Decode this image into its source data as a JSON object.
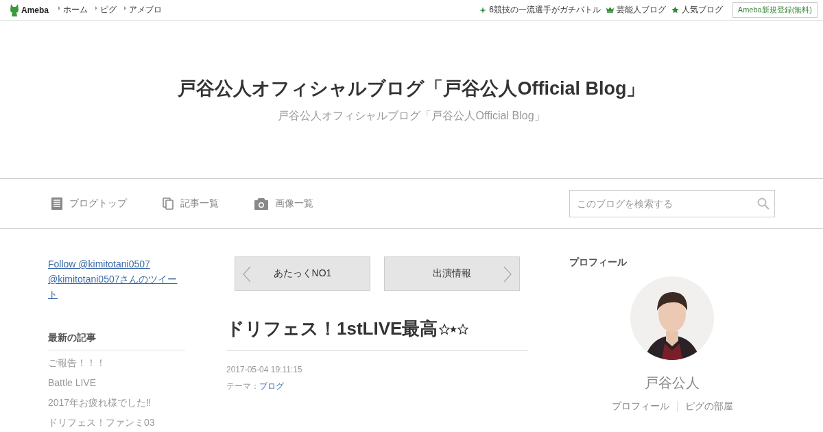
{
  "topbar": {
    "logo": "Ameba",
    "links": [
      "ホーム",
      "ピグ",
      "アメブロ"
    ],
    "promos": [
      {
        "kind": "sparkle",
        "label": "6競技の一流選手がガチバトル"
      },
      {
        "kind": "crown",
        "label": "芸能人ブログ"
      },
      {
        "kind": "star",
        "label": "人気ブログ"
      }
    ],
    "signup": "Ameba新規登録(無料)"
  },
  "header": {
    "title": "戸谷公人オフィシャルブログ「戸谷公人Official Blog」",
    "subtitle": "戸谷公人オフィシャルブログ「戸谷公人Official Blog」"
  },
  "nav": {
    "items": [
      {
        "kind": "top",
        "label": "ブログトップ"
      },
      {
        "kind": "list",
        "label": "記事一覧"
      },
      {
        "kind": "images",
        "label": "画像一覧"
      }
    ],
    "search": {
      "placeholder": "このブログを検索する"
    }
  },
  "sidebar": {
    "twitter": [
      "Follow @kimitotani0507",
      "@kimitotani0507さんのツイート"
    ],
    "recent": {
      "heading": "最新の記事",
      "items": [
        "ご報告！！！",
        "Battle LIVE",
        "2017年お疲れ様でした‼",
        "ドリフェス！ファンミ03"
      ]
    }
  },
  "article": {
    "prev": "あたっくNO1",
    "next": "出演情報",
    "title": "ドリフェス！1stLIVE最高",
    "date": "2017-05-04 19:11:15",
    "theme_label": "テーマ：",
    "theme": "ブログ"
  },
  "profile": {
    "heading": "プロフィール",
    "photo": {
      "kind": "picture"
    },
    "name": "戸谷公人",
    "links": [
      "プロフィール",
      "ピグの部屋"
    ]
  }
}
